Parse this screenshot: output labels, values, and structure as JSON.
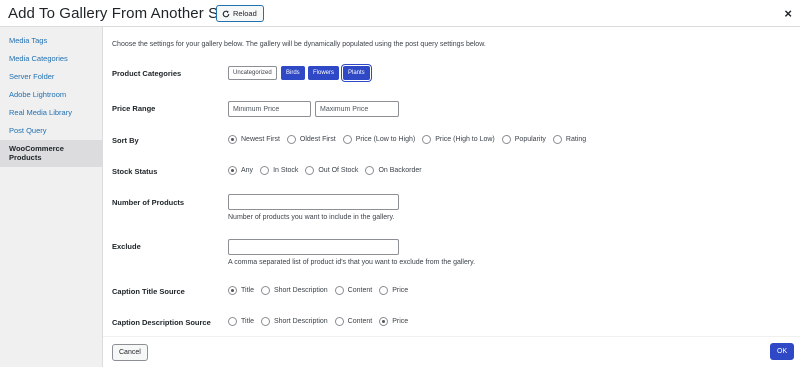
{
  "header": {
    "title": "Add To Gallery From Another Source",
    "reload_label": "Reload",
    "close_glyph": "×"
  },
  "sidebar": {
    "items": [
      {
        "label": "Media Tags"
      },
      {
        "label": "Media Categories"
      },
      {
        "label": "Server Folder"
      },
      {
        "label": "Adobe Lightroom"
      },
      {
        "label": "Real Media Library"
      },
      {
        "label": "Post Query"
      },
      {
        "label": "WooCommerce Products"
      }
    ]
  },
  "main": {
    "intro": "Choose the settings for your gallery below. The gallery will be dynamically populated using the post query settings below.",
    "product_categories": {
      "label": "Product Categories",
      "chips": [
        "Uncategorized",
        "Birds",
        "Flowers",
        "Plants"
      ]
    },
    "price_range": {
      "label": "Price Range",
      "min_placeholder": "Minimum Price",
      "max_placeholder": "Maximum Price"
    },
    "sort_by": {
      "label": "Sort By",
      "options": [
        "Newest First",
        "Oldest First",
        "Price (Low to High)",
        "Price (High to Low)",
        "Popularity",
        "Rating"
      ]
    },
    "stock_status": {
      "label": "Stock Status",
      "options": [
        "Any",
        "In Stock",
        "Out Of Stock",
        "On Backorder"
      ]
    },
    "number_of_products": {
      "label": "Number of Products",
      "value": "",
      "help": "Number of products you want to include in the gallery."
    },
    "exclude": {
      "label": "Exclude",
      "value": "",
      "help": "A comma separated list of product id's that you want to exclude from the gallery."
    },
    "caption_title_source": {
      "label": "Caption Title Source",
      "options": [
        "Title",
        "Short Description",
        "Content",
        "Price"
      ]
    },
    "caption_description_source": {
      "label": "Caption Description Source",
      "options": [
        "Title",
        "Short Description",
        "Content",
        "Price"
      ]
    }
  },
  "footer": {
    "cancel_label": "Cancel",
    "ok_label": "OK"
  },
  "colors": {
    "accent": "#2f48c5",
    "link": "#2271b1",
    "sidebar_bg": "#f0f0f1"
  },
  "icons": {
    "reload": "reload-icon",
    "close": "close-icon"
  }
}
